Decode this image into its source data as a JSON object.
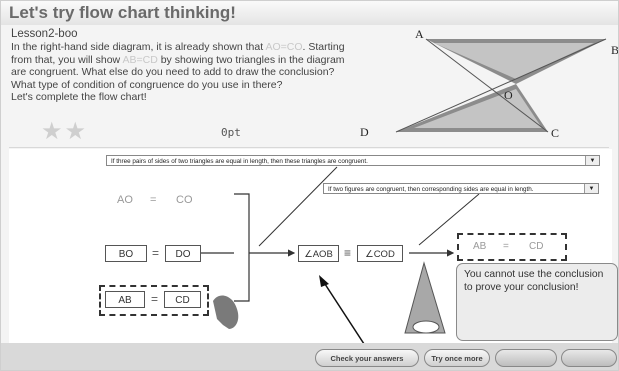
{
  "header": {
    "title": "Let's try flow chart thinking!"
  },
  "lesson": {
    "name": "Lesson2-boo",
    "line1_a": "In the right-hand side diagram, it is already shown that ",
    "line1_hl": "AO=CO",
    "line1_b": ". Starting",
    "line2_a": "from that, you will show ",
    "line2_hl": "AB=CD",
    "line2_b": " by showing two triangles in the diagram",
    "line3": "are congruent. What else do you need to add to draw the conclusion?",
    "line4": "What type of condition of congruence do you use in there?",
    "line5": "Let's complete the flow chart!"
  },
  "progress": {
    "stars": "★★",
    "score": "0pt"
  },
  "diagram": {
    "labels": {
      "a": "A",
      "b": "B",
      "o": "O",
      "d": "D",
      "c": "C"
    }
  },
  "flow": {
    "condition_select": "If three pairs of sides of two triangles are equal in length, then these triangles are congruent.",
    "consequence_select": "If two figures are congruent, then corresponding sides are equal in length.",
    "given": {
      "left": "AO",
      "eq": "=",
      "right": "CO"
    },
    "step2": {
      "left": "BO",
      "eq": "=",
      "right": "DO"
    },
    "step3": {
      "left": "AB",
      "eq": "=",
      "right": "CD"
    },
    "angles": {
      "left": "∠AOB",
      "eq": "≡",
      "right": "∠COD"
    },
    "conclusion": {
      "left": "AB",
      "eq": "=",
      "right": "CD"
    }
  },
  "hint": {
    "text": "You cannot use the conclusion to prove your conclusion!"
  },
  "buttons": {
    "check": "Check your answers",
    "retry": "Try once more"
  }
}
